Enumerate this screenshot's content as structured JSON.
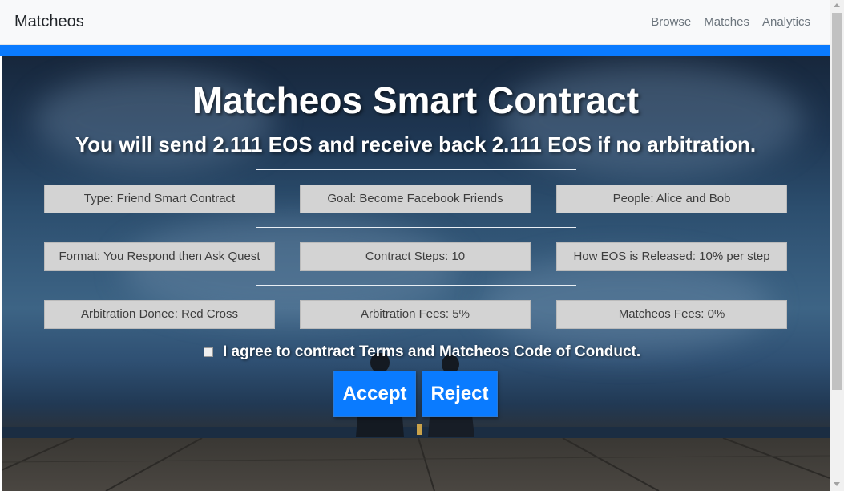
{
  "navbar": {
    "brand": "Matcheos",
    "links": [
      {
        "label": "Browse"
      },
      {
        "label": "Matches"
      },
      {
        "label": "Analytics"
      }
    ]
  },
  "contract": {
    "title": "Matcheos Smart Contract",
    "subtitle": "You will send 2.111 EOS and receive back 2.111 EOS if no arbitration.",
    "fields": [
      {
        "value": "Type: Friend Smart Contract"
      },
      {
        "value": "Goal: Become Facebook Friends"
      },
      {
        "value": "People: Alice and Bob"
      },
      {
        "value": "Format: You Respond then Ask Quest"
      },
      {
        "value": "Contract Steps: 10"
      },
      {
        "value": "How EOS is Released: 10% per step"
      },
      {
        "value": "Arbitration Donee: Red Cross"
      },
      {
        "value": "Arbitration Fees: 5%"
      },
      {
        "value": "Matcheos Fees: 0%"
      }
    ],
    "agree_label": "I agree to contract Terms and Matcheos Code of Conduct.",
    "agree_checked": false,
    "accept_label": "Accept",
    "reject_label": "Reject"
  },
  "colors": {
    "accent": "#0a7bff",
    "field_bg": "#d3d3d3",
    "navbar_bg": "#f8f9fa"
  }
}
